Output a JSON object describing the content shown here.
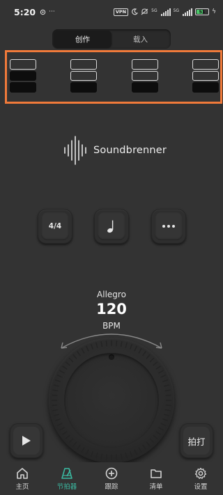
{
  "status_bar": {
    "time": "5:20",
    "vpn": "VPN",
    "network1": "5G",
    "network2": "5G",
    "battery": "51"
  },
  "tabs": [
    {
      "label": "创作",
      "active": true
    },
    {
      "label": "载入",
      "active": false
    }
  ],
  "beats": [
    {
      "accent": "strong"
    },
    {
      "accent": "medium"
    },
    {
      "accent": "medium"
    },
    {
      "accent": "medium"
    }
  ],
  "brand": {
    "name": "Soundbrenner"
  },
  "controls": {
    "time_signature": "4/4",
    "note_icon": "quarter-note-icon",
    "more_icon": "more-dots-icon"
  },
  "tempo": {
    "name": "Allegro",
    "bpm": "120",
    "unit": "BPM"
  },
  "buttons": {
    "play_icon": "play-icon",
    "tap_label": "拍打"
  },
  "nav": [
    {
      "label": "主页",
      "icon": "home-icon",
      "active": false
    },
    {
      "label": "节拍器",
      "icon": "metronome-icon",
      "active": true
    },
    {
      "label": "跟踪",
      "icon": "plus-circle-icon",
      "active": false
    },
    {
      "label": "清单",
      "icon": "folder-icon",
      "active": false
    },
    {
      "label": "设置",
      "icon": "gear-icon",
      "active": false
    }
  ],
  "colors": {
    "background": "#333333",
    "accent": "#3bb9a1",
    "highlight": "#f07a3a"
  }
}
